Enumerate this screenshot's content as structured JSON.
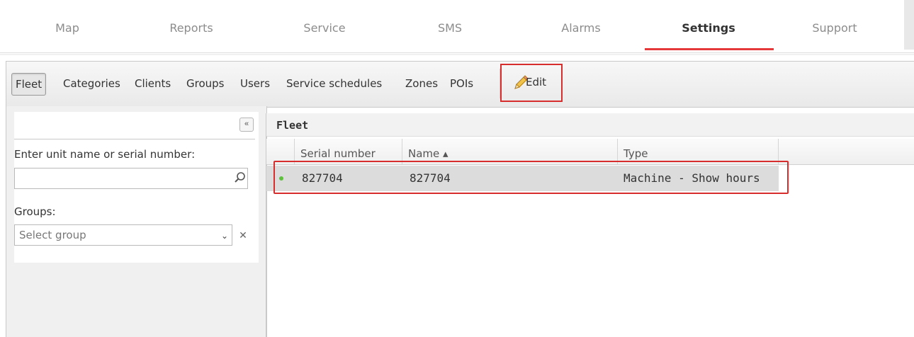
{
  "topnav": {
    "items": [
      {
        "label": "Map"
      },
      {
        "label": "Reports"
      },
      {
        "label": "Service"
      },
      {
        "label": "SMS"
      },
      {
        "label": "Alarms"
      },
      {
        "label": "Settings",
        "active": true
      },
      {
        "label": "Support"
      }
    ],
    "accent_color": "#e5383b"
  },
  "tabs": {
    "items": [
      {
        "label": "Fleet",
        "active": true
      },
      {
        "label": "Categories"
      },
      {
        "label": "Clients"
      },
      {
        "label": "Groups"
      },
      {
        "label": "Users"
      },
      {
        "label": "Service schedules"
      },
      {
        "label": "Zones"
      },
      {
        "label": "POIs"
      }
    ],
    "edit_label": "Edit",
    "edit_icon": "pencil-icon"
  },
  "left_panel": {
    "collapse_icon": "«",
    "search_label": "Enter unit name or serial number:",
    "search_value": "",
    "search_icon": "search-icon",
    "groups_label": "Groups:",
    "groups_placeholder": "Select group",
    "dropdown_icon": "⌄",
    "clear_icon": "✕"
  },
  "grid": {
    "title": "Fleet",
    "columns": [
      {
        "label": "Serial number"
      },
      {
        "label": "Name ▴",
        "sort": "ascending"
      },
      {
        "label": "Type"
      }
    ],
    "rows": [
      {
        "status": "online",
        "serial": "827704",
        "name": "827704",
        "type": "Machine - Show hours"
      }
    ],
    "highlight_color": "#d72d2d"
  }
}
